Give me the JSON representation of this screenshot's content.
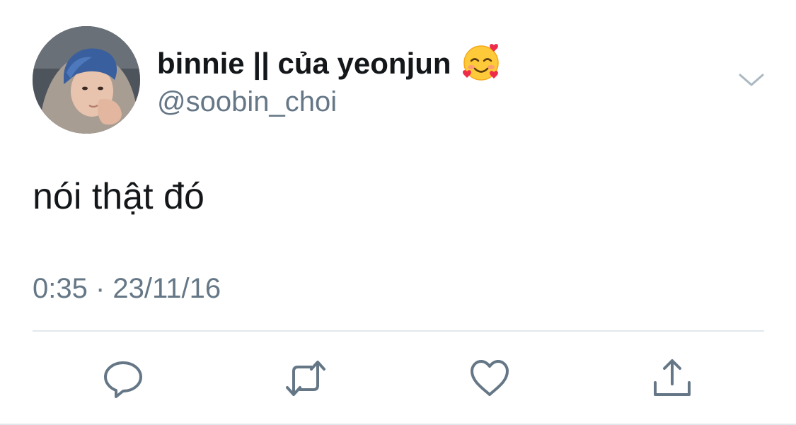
{
  "user": {
    "display_name": "binnie || của yeonjun",
    "name_emoji": "smiling-face-with-hearts-icon",
    "handle": "@soobin_choi"
  },
  "tweet": {
    "text": "nói thật đó",
    "timestamp": "0:35 · 23/11/16"
  },
  "actions": {
    "reply": "reply-icon",
    "retweet": "retweet-icon",
    "like": "heart-icon",
    "share": "share-icon"
  },
  "colors": {
    "text_primary": "#14171a",
    "text_secondary": "#657786",
    "divider": "#e1e8ed",
    "icon_gray": "#657786",
    "chevron": "#aab8c2"
  }
}
